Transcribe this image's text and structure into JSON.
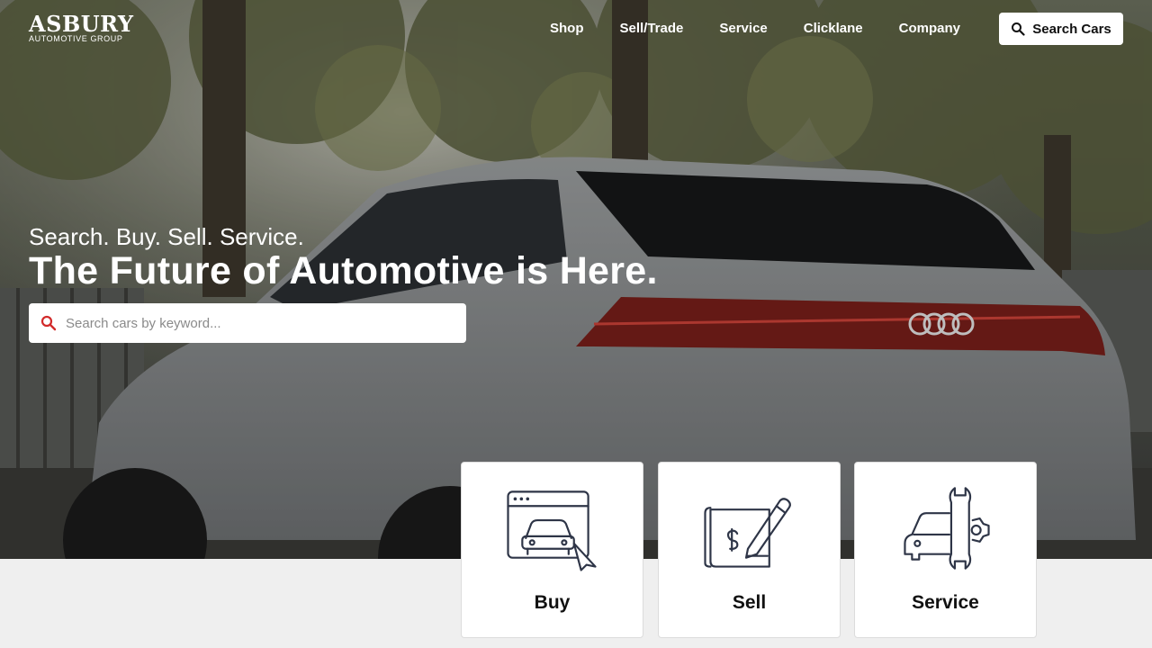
{
  "brand": {
    "name": "ASBURY",
    "subtitle": "AUTOMOTIVE GROUP"
  },
  "nav": {
    "items": [
      "Shop",
      "Sell/Trade",
      "Service",
      "Clicklane",
      "Company"
    ],
    "search_button": "Search Cars"
  },
  "hero": {
    "tagline": "Search. Buy. Sell. Service.",
    "headline": "The Future of Automotive is Here.",
    "search": {
      "placeholder": "Search cars by keyword...",
      "value": ""
    }
  },
  "cards": [
    {
      "label": "Buy",
      "icon": "browser-car-icon"
    },
    {
      "label": "Sell",
      "icon": "contract-pen-icon"
    },
    {
      "label": "Service",
      "icon": "car-wrench-icon"
    }
  ],
  "colors": {
    "search_icon_accent": "#d22b2b",
    "icon_stroke": "#2e3547",
    "page_background": "#efefef"
  }
}
